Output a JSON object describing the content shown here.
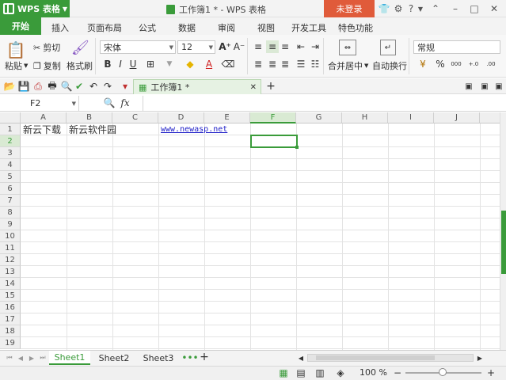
{
  "app": {
    "name": "WPS 表格",
    "doc_title": "工作簿1 * - WPS 表格",
    "login_label": "未登录"
  },
  "tabs": [
    "开始",
    "插入",
    "页面布局",
    "公式",
    "数据",
    "审阅",
    "视图",
    "开发工具",
    "特色功能"
  ],
  "ribbon": {
    "paste": "粘贴",
    "cut": "剪切",
    "copy": "复制",
    "format_painter": "格式刷",
    "font_name": "宋体",
    "font_size": "12",
    "merge_center": "合并居中",
    "wrap_text": "自动换行",
    "number_format": "常规",
    "percent": "%",
    "comma": "000",
    "inc_decimal": "+.0",
    "dec_decimal": ".00"
  },
  "doc_tab": {
    "label": "工作簿1 *"
  },
  "formula_bar": {
    "cell_ref": "F2",
    "fx": "fx",
    "value": ""
  },
  "grid": {
    "columns": [
      "A",
      "B",
      "C",
      "D",
      "E",
      "F",
      "G",
      "H",
      "I",
      "J"
    ],
    "rows": [
      "1",
      "2",
      "3",
      "4",
      "5",
      "6",
      "7",
      "8",
      "9",
      "10",
      "11",
      "12",
      "13",
      "14",
      "15",
      "16",
      "17",
      "18",
      "19"
    ],
    "selected_cell": "F2",
    "cells": {
      "A1": "新云下载",
      "B1": "新云软件园",
      "D1": "www.newasp.net"
    },
    "link_color": "#2020c8",
    "selection_color": "#3a9b3a"
  },
  "sheets": [
    "Sheet1",
    "Sheet2",
    "Sheet3"
  ],
  "active_sheet": "Sheet1",
  "status": {
    "zoom": "100 %"
  },
  "colors": {
    "accent": "#3a9b3a",
    "login": "#e05b3a"
  }
}
